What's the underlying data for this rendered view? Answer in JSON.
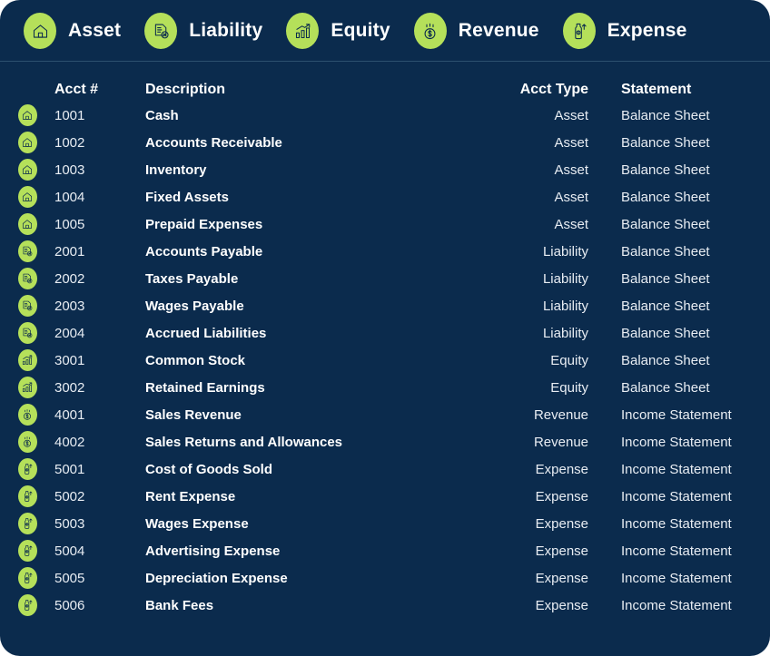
{
  "theme": {
    "card_bg": "#0b2b4d",
    "accent_green": "#b5e05a",
    "icon_glyph": "#0b2b4d",
    "text_primary": "#ffffff",
    "text_secondary": "#e8edf3",
    "divider": "#4a6f8c"
  },
  "legend": {
    "items": [
      {
        "label": "Asset",
        "icon": "home-icon"
      },
      {
        "label": "Liability",
        "icon": "document-badge-icon"
      },
      {
        "label": "Equity",
        "icon": "bar-chart-arrow-icon"
      },
      {
        "label": "Revenue",
        "icon": "coin-dollar-icon"
      },
      {
        "label": "Expense",
        "icon": "money-bottle-arrow-icon"
      }
    ]
  },
  "table": {
    "columns": {
      "acct": "Acct #",
      "description": "Description",
      "acct_type": "Acct Type",
      "statement": "Statement"
    },
    "rows": [
      {
        "icon": "home-icon",
        "acct": "1001",
        "description": "Cash",
        "acct_type": "Asset",
        "statement": "Balance Sheet"
      },
      {
        "icon": "home-icon",
        "acct": "1002",
        "description": "Accounts Receivable",
        "acct_type": "Asset",
        "statement": "Balance Sheet"
      },
      {
        "icon": "home-icon",
        "acct": "1003",
        "description": "Inventory",
        "acct_type": "Asset",
        "statement": "Balance Sheet"
      },
      {
        "icon": "home-icon",
        "acct": "1004",
        "description": "Fixed Assets",
        "acct_type": "Asset",
        "statement": "Balance Sheet"
      },
      {
        "icon": "home-icon",
        "acct": "1005",
        "description": "Prepaid Expenses",
        "acct_type": "Asset",
        "statement": "Balance Sheet"
      },
      {
        "icon": "document-badge-icon",
        "acct": "2001",
        "description": "Accounts Payable",
        "acct_type": "Liability",
        "statement": "Balance Sheet"
      },
      {
        "icon": "document-badge-icon",
        "acct": "2002",
        "description": "Taxes Payable",
        "acct_type": "Liability",
        "statement": "Balance Sheet"
      },
      {
        "icon": "document-badge-icon",
        "acct": "2003",
        "description": "Wages Payable",
        "acct_type": "Liability",
        "statement": "Balance Sheet"
      },
      {
        "icon": "document-badge-icon",
        "acct": "2004",
        "description": "Accrued Liabilities",
        "acct_type": "Liability",
        "statement": "Balance Sheet"
      },
      {
        "icon": "bar-chart-arrow-icon",
        "acct": "3001",
        "description": "Common Stock",
        "acct_type": "Equity",
        "statement": "Balance Sheet"
      },
      {
        "icon": "bar-chart-arrow-icon",
        "acct": "3002",
        "description": "Retained Earnings",
        "acct_type": "Equity",
        "statement": "Balance Sheet"
      },
      {
        "icon": "coin-dollar-icon",
        "acct": "4001",
        "description": "Sales Revenue",
        "acct_type": "Revenue",
        "statement": "Income Statement"
      },
      {
        "icon": "coin-dollar-icon",
        "acct": "4002",
        "description": "Sales Returns and Allowances",
        "acct_type": "Revenue",
        "statement": "Income Statement"
      },
      {
        "icon": "money-bottle-arrow-icon",
        "acct": "5001",
        "description": "Cost of Goods Sold",
        "acct_type": "Expense",
        "statement": "Income Statement"
      },
      {
        "icon": "money-bottle-arrow-icon",
        "acct": "5002",
        "description": "Rent Expense",
        "acct_type": "Expense",
        "statement": "Income Statement"
      },
      {
        "icon": "money-bottle-arrow-icon",
        "acct": "5003",
        "description": "Wages Expense",
        "acct_type": "Expense",
        "statement": "Income Statement"
      },
      {
        "icon": "money-bottle-arrow-icon",
        "acct": "5004",
        "description": "Advertising Expense",
        "acct_type": "Expense",
        "statement": "Income Statement"
      },
      {
        "icon": "money-bottle-arrow-icon",
        "acct": "5005",
        "description": "Depreciation Expense",
        "acct_type": "Expense",
        "statement": "Income Statement"
      },
      {
        "icon": "money-bottle-arrow-icon",
        "acct": "5006",
        "description": "Bank Fees",
        "acct_type": "Expense",
        "statement": "Income Statement"
      }
    ]
  }
}
